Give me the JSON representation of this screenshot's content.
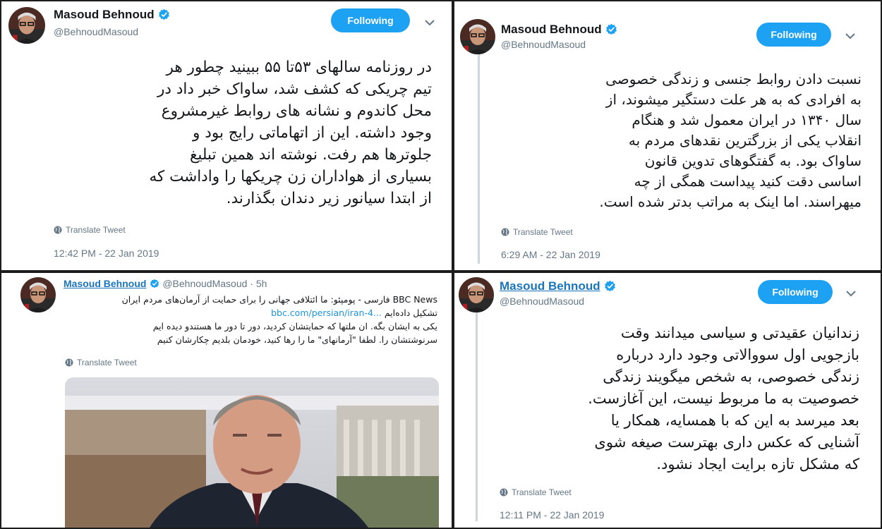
{
  "colors": {
    "accent": "#1da1f2",
    "link": "#1b75bc",
    "muted": "#657786",
    "text": "#14171a"
  },
  "icons": {
    "verified": "verified-badge-icon",
    "chevron": "chevron-down-icon",
    "globe": "globe-icon"
  },
  "tweets": [
    {
      "name": "Masoud Behnoud",
      "handle": "@BehnoudMasoud",
      "follow": "Following",
      "lines": [
        "در روزنامه سالهای ۵۳تا ۵۵  ببینید چطور هر",
        "تیم چریکی که کشف شد، ساواک خبر داد در",
        "محل کاندوم و نشانه های روابط غیرمشروع",
        "وجود داشته. این از اتهاماتی رایج بود و",
        "جلوترها هم رفت. نوشته اند همین تبلیغ",
        "بسیاری از هواداران زن چریکها را واداشت که",
        "از ابتدا سیانور زیر دندان بگذارند."
      ],
      "translate": "Translate Tweet",
      "time": "12:42 PM - 22 Jan 2019"
    },
    {
      "name": "Masoud Behnoud",
      "handle": "@BehnoudMasoud",
      "follow": "Following",
      "lines": [
        "نسبت دادن روابط جنسی و زندگی خصوصی",
        "به افرادی که به هر علت دستگیر میشوند، از",
        "سال ۱۳۴۰ در ایران معمول شد و هنگام",
        "انقلاب یکی از بزرگترین نقدهای مردم به",
        "ساواک بود. به گفتگوهای تدوین قانون",
        "اساسی دقت کنید پیداست همگی از چه",
        "میهراسند. اما اینک به مراتب بدتر شده است."
      ],
      "translate": "Translate Tweet",
      "time": "6:29 AM - 22 Jan 2019"
    },
    {
      "name": "Masoud Behnoud",
      "handle": "@BehnoudMasoud",
      "age": "5h",
      "quote_source": "BBC News",
      "quote_title_1": "فارسی - پومپئو: ما ائتلافی جهانی را برای حمایت از آرمان‌های مردم ایران",
      "quote_title_2": "تشکیل داده‌ایم",
      "link": "bbc.com/persian/iran-4...",
      "comment_1": "یکی به ایشان بگه. ان ملتها که حمایتشان کردید، دور تا دور ما هستندو دیده ایم",
      "comment_2": "سرنوشتشان را. لطفا \"آرمانهای\" ما را رها کنید، خودمان بلدیم چکارشان کنیم",
      "translate": "Translate Tweet"
    },
    {
      "name": "Masoud Behnoud",
      "handle": "@BehnoudMasoud",
      "follow": "Following",
      "lines": [
        "زندانیان عقیدتی و سیاسی میدانند وقت",
        "بازجویی اول سووالاتی وجود دارد درباره",
        "زندگی خصوصی، به شخص میگویند زندگی",
        "خصوصیت به ما مربوط نیست، این آغازست.",
        "بعد میرسد به این که با همسایه، همکار یا",
        "آشنایی که عکس داری بهترست صیغه شوی",
        "که مشکل تازه برایت ایجاد نشود."
      ],
      "translate": "Translate Tweet",
      "time": "12:11 PM - 22 Jan 2019"
    }
  ]
}
